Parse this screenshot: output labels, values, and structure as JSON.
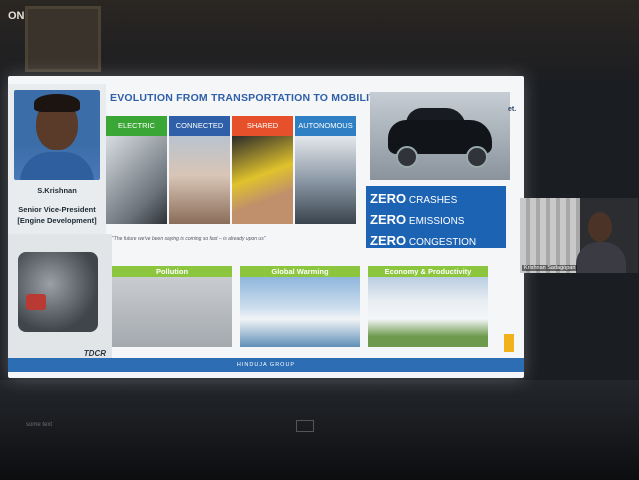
{
  "corner_label": "ON",
  "slide": {
    "title": "EVOLUTION FROM TRANSPORTATION TO MOBILITY",
    "speaker": {
      "name": "S.Krishnan",
      "role_line1": "Senior Vice-President",
      "role_line2": "[Engine Development]"
    },
    "engine_brand": "TDCR",
    "tiles": [
      {
        "label": "ELECTRIC",
        "color": "#3aa635"
      },
      {
        "label": "CONNECTED",
        "color": "#2f5fa8"
      },
      {
        "label": "SHARED",
        "color": "#e6512b"
      },
      {
        "label": "AUTONOMOUS",
        "color": "#2f7fc4"
      }
    ],
    "note": "\"The future we've been saying is coming so fast – is already upon us\"",
    "zero": [
      {
        "big": "ZERO",
        "small": "CRASHES"
      },
      {
        "big": "ZERO",
        "small": "EMISSIONS"
      },
      {
        "big": "ZERO",
        "small": "CONGESTION"
      }
    ],
    "bottom_tiles": [
      {
        "label": "Pollution"
      },
      {
        "label": "Global Warming"
      },
      {
        "label": "Economy & Productivity"
      }
    ],
    "footer": "HINDUJA GROUP",
    "right_edge_text": "et."
  },
  "participant": {
    "name": "Krishnan Sadagopan"
  },
  "bezel_text": "some text"
}
